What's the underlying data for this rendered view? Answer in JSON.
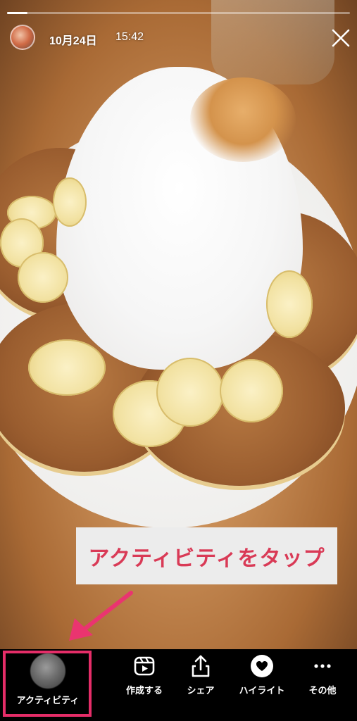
{
  "story": {
    "progress": 0.06,
    "date": "10月24日",
    "time": "15:42"
  },
  "callout": {
    "text": "アクティビティをタップ"
  },
  "bottom_bar": {
    "items": [
      {
        "label": "アクティビティ",
        "icon": "activity-avatar"
      },
      {
        "label": "作成する",
        "icon": "reels-icon"
      },
      {
        "label": "シェア",
        "icon": "share-icon"
      },
      {
        "label": "ハイライト",
        "icon": "heart-icon"
      },
      {
        "label": "その他",
        "icon": "more-icon"
      }
    ]
  },
  "colors": {
    "callout_text": "#d93a56",
    "highlight_border": "#e52d68",
    "arrow": "#ea3470"
  }
}
